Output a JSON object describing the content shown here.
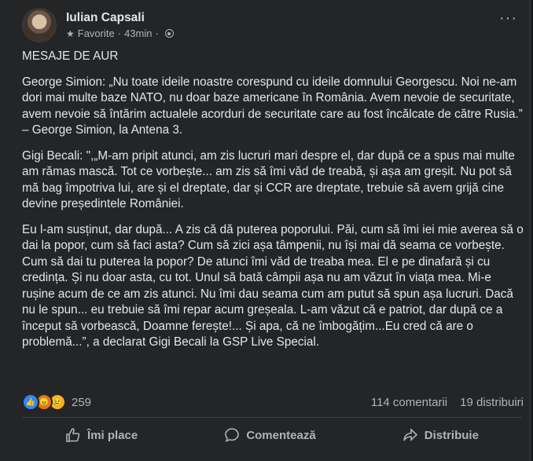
{
  "post": {
    "author": "Iulian Capsali",
    "favorite_label": "Favorite",
    "separator": "·",
    "time": "43min",
    "title": "MESAJE DE AUR",
    "paragraphs": [
      "George Simion: „Nu toate ideile noastre corespund cu ideile domnului Georgescu. Noi ne-am dori mai multe baze NATO, nu doar baze americane în România. Avem nevoie de securitate, avem nevoie să întărim actualele acorduri de securitate care au fost încălcate de către Rusia.” – George Simion, la Antena 3.",
      "Gigi Becali: \",„M-am pripit atunci, am zis lucruri mari despre el, dar după ce a spus mai multe am rămas mască. Tot ce vorbește... am zis să îmi văd de treabă, și așa am greșit. Nu pot să mă bag împotriva lui, are și el dreptate, dar și CCR are dreptate, trebuie să avem grijă cine devine președintele României.",
      "Eu l-am susținut, dar după... A zis că dă puterea poporului. Păi, cum să îmi iei mie averea să o dai la popor, cum să faci asta? Cum să zici așa tâmpenii, nu își mai dă seama ce vorbește. Cum să dai tu puterea la popor? De atunci îmi văd de treaba mea. El e pe dinafară și cu credința. Și nu doar asta, cu tot. Unul să bată câmpii așa nu am văzut în viața mea. Mi-e rușine acum de ce am zis atunci. Nu îmi dau seama cum am putut să spun așa lucruri. Dacă nu le spun... eu trebuie să îmi repar acum greșeala. L-am văzut că e patriot, dar după ce a început să vorbească, Doamne ferește!... Și apa, că ne îmbogățim...Eu cred că are o problemă...”, a declarat Gigi Becali la GSP Live Special."
    ]
  },
  "stats": {
    "reactions_count": "259",
    "comments": "114 comentarii",
    "shares": "19 distribuiri"
  },
  "actions": {
    "like": "Îmi place",
    "comment": "Comentează",
    "share": "Distribuie"
  },
  "icons": [
    "star-icon",
    "globe-icon",
    "more-options-icon",
    "like-reaction-icon",
    "angry-reaction-icon",
    "sad-reaction-icon",
    "like-icon",
    "comment-icon",
    "share-icon"
  ]
}
